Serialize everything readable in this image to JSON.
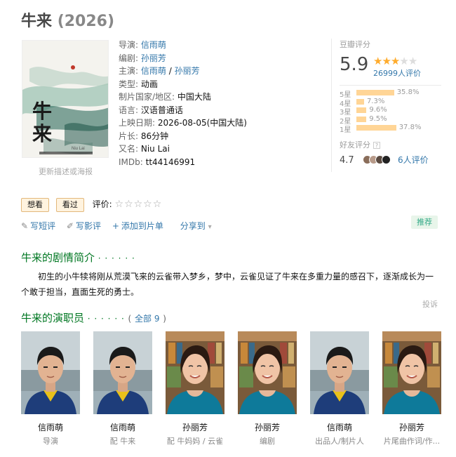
{
  "header": {
    "title": "牛来",
    "year": "(2026)"
  },
  "poster": {
    "link_text": "更新描述或海报",
    "art_title": "牛来",
    "art_sub": "Niu Lai"
  },
  "info": {
    "director": {
      "label": "导演",
      "value": "信雨萌"
    },
    "writer": {
      "label": "编剧",
      "value": "孙丽芳"
    },
    "cast": {
      "label": "主演",
      "values": [
        "信雨萌",
        "孙丽芳"
      ],
      "sep": " / "
    },
    "genre": {
      "label": "类型:",
      "value": "动画"
    },
    "region": {
      "label": "制片国家/地区:",
      "value": "中国大陆"
    },
    "language": {
      "label": "语言:",
      "value": "汉语普通话"
    },
    "release": {
      "label": "上映日期:",
      "value": "2026-08-05(中国大陆)"
    },
    "runtime": {
      "label": "片长:",
      "value": "86分钟"
    },
    "aka": {
      "label": "又名:",
      "value": "Niu Lai"
    },
    "imdb": {
      "label": "IMDb:",
      "value": "tt44146991"
    }
  },
  "rating": {
    "label": "豆瓣评分",
    "score": "5.9",
    "stars_filled": 3,
    "stars_total": 5,
    "votes": "26999人评价",
    "distribution": [
      {
        "label": "5星",
        "pct": "35.8%",
        "value": 35.8
      },
      {
        "label": "4星",
        "pct": "7.3%",
        "value": 7.3
      },
      {
        "label": "3星",
        "pct": "9.6%",
        "value": 9.6
      },
      {
        "label": "2星",
        "pct": "9.5%",
        "value": 9.5
      },
      {
        "label": "1星",
        "pct": "37.8%",
        "value": 37.8
      }
    ],
    "bar_color": "#ffd596",
    "star_color": "#ffac2d"
  },
  "friends": {
    "label": "好友评分",
    "score": "4.7",
    "count": "6人评价"
  },
  "actions": {
    "want": "想看",
    "watched": "看过",
    "rate_label": "评价:",
    "write_short": "写短评",
    "write_review": "写影评",
    "add_to_list": "添加到片单",
    "share": "分享到",
    "recommend": "推荐"
  },
  "synopsis": {
    "title": "牛来的剧情简介",
    "dots": "· · · · · ·",
    "text": "初生的小牛犊将刚从荒漠飞来的云雀带入梦乡，梦中，云雀见证了牛来在多重力量的感召下，逐渐成长为一个敢于担当，直面生死的勇士。",
    "report": "投诉"
  },
  "cast_section": {
    "title": "牛来的演职员",
    "dots": "· · · · · ·",
    "all_open": "(",
    "all_label": "全部 9",
    "all_close": ")",
    "members": [
      {
        "name": "信雨萌",
        "role": "导演",
        "kind": "male"
      },
      {
        "name": "信雨萌",
        "role": "配 牛来",
        "kind": "male"
      },
      {
        "name": "孙丽芳",
        "role": "配 牛妈妈 / 云雀",
        "kind": "female"
      },
      {
        "name": "孙丽芳",
        "role": "编剧",
        "kind": "female"
      },
      {
        "name": "信雨萌",
        "role": "出品人/制片人",
        "kind": "male"
      },
      {
        "name": "孙丽芳",
        "role": "片尾曲作词/作...",
        "kind": "female"
      }
    ]
  }
}
